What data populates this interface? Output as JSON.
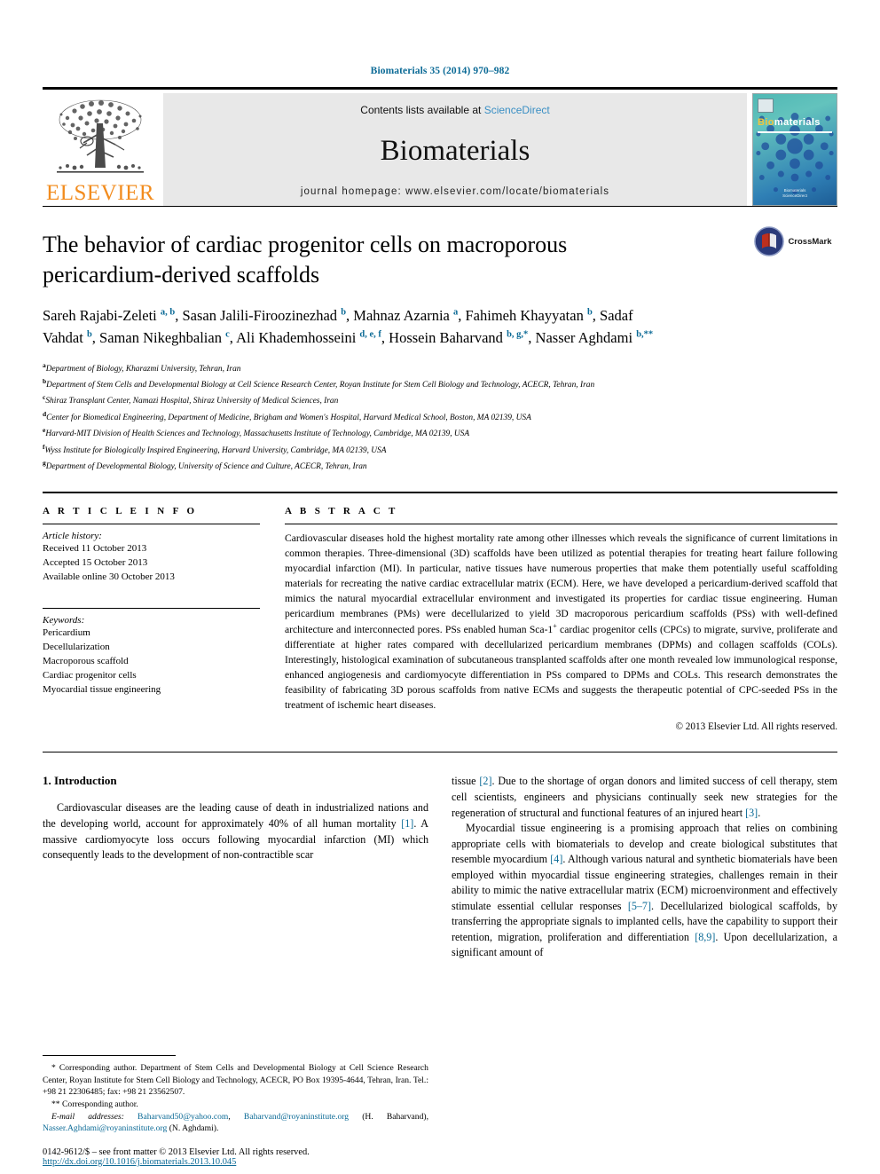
{
  "running_head": "Biomaterials 35 (2014) 970–982",
  "masthead": {
    "publisher_name": "ELSEVIER",
    "contents_prefix": "Contents lists available at ",
    "sciencedirect": "ScienceDirect",
    "journal_title": "Biomaterials",
    "homepage": "journal homepage: www.elsevier.com/locate/biomaterials",
    "cover": {
      "word_bio": "Bio",
      "word_rest": "materials",
      "footer_line1": "Biomaterials",
      "footer_line2": "ScienceDirect"
    }
  },
  "title": "The behavior of cardiac progenitor cells on macroporous pericardium-derived scaffolds",
  "crossmark_label": "CrossMark",
  "authors_html": "Sareh Rajabi-Zeleti <sup>a, b</sup>, Sasan Jalili-Firoozinezhad <sup>b</sup>, Mahnaz Azarnia <sup>a</sup>, Fahimeh Khayyatan <sup>b</sup>, Sadaf Vahdat <sup>b</sup>, Saman Nikeghbalian <sup>c</sup>, Ali Khademhosseini <sup>d, e, f</sup>, Hossein Baharvand <sup>b, g,</sup><sup>*</sup>, Nasser Aghdami <sup>b,</sup><sup>**</sup>",
  "affiliations": [
    {
      "marker": "a",
      "text": "Department of Biology, Kharazmi University, Tehran, Iran"
    },
    {
      "marker": "b",
      "text": "Department of Stem Cells and Developmental Biology at Cell Science Research Center, Royan Institute for Stem Cell Biology and Technology, ACECR, Tehran, Iran"
    },
    {
      "marker": "c",
      "text": "Shiraz Transplant Center, Namazi Hospital, Shiraz University of Medical Sciences, Iran"
    },
    {
      "marker": "d",
      "text": "Center for Biomedical Engineering, Department of Medicine, Brigham and Women's Hospital, Harvard Medical School, Boston, MA 02139, USA"
    },
    {
      "marker": "e",
      "text": "Harvard-MIT Division of Health Sciences and Technology, Massachusetts Institute of Technology, Cambridge, MA 02139, USA"
    },
    {
      "marker": "f",
      "text": "Wyss Institute for Biologically Inspired Engineering, Harvard University, Cambridge, MA 02139, USA"
    },
    {
      "marker": "g",
      "text": "Department of Developmental Biology, University of Science and Culture, ACECR, Tehran, Iran"
    }
  ],
  "article_info": {
    "heading": "A R T I C L E   I N F O",
    "history_label": "Article history:",
    "history": [
      "Received 11 October 2013",
      "Accepted 15 October 2013",
      "Available online 30 October 2013"
    ],
    "keywords_label": "Keywords:",
    "keywords": [
      "Pericardium",
      "Decellularization",
      "Macroporous scaffold",
      "Cardiac progenitor cells",
      "Myocardial tissue engineering"
    ]
  },
  "abstract": {
    "heading": "A B S T R A C T",
    "part1": "Cardiovascular diseases hold the highest mortality rate among other illnesses which reveals the significance of current limitations in common therapies. Three-dimensional (3D) scaffolds have been utilized as potential therapies for treating heart failure following myocardial infarction (MI). In particular, native tissues have numerous properties that make them potentially useful scaffolding materials for recreating the native cardiac extracellular matrix (ECM). Here, we have developed a pericardium-derived scaffold that mimics the natural myocardial extracellular environment and investigated its properties for cardiac tissue engineering. Human pericardium membranes (PMs) were decellularized to yield 3D macroporous pericardium scaffolds (PSs) with well-defined architecture and interconnected pores. PSs enabled human Sca-1",
    "sup": "+",
    "part2": " cardiac progenitor cells (CPCs) to migrate, survive, proliferate and differentiate at higher rates compared with decellularized pericardium membranes (DPMs) and collagen scaffolds (COLs). Interestingly, histological examination of subcutaneous transplanted scaffolds after one month revealed low immunological response, enhanced angiogenesis and cardiomyocyte differentiation in PSs compared to DPMs and COLs. This research demonstrates the feasibility of fabricating 3D porous scaffolds from native ECMs and suggests the therapeutic potential of CPC-seeded PSs in the treatment of ischemic heart diseases.",
    "copyright": "© 2013 Elsevier Ltd. All rights reserved."
  },
  "body": {
    "section_heading": "1. Introduction",
    "left_par1_a": "Cardiovascular diseases are the leading cause of death in industrialized nations and the developing world, account for approximately 40% of all human mortality ",
    "left_ref1": "[1]",
    "left_par1_b": ". A massive cardiomyocyte loss occurs following myocardial infarction (MI) which consequently leads to the development of non-contractible scar",
    "right_par1_a": "tissue ",
    "right_ref2": "[2]",
    "right_par1_b": ". Due to the shortage of organ donors and limited success of cell therapy, stem cell scientists, engineers and physicians continually seek new strategies for the regeneration of structural and functional features of an injured heart ",
    "right_ref3": "[3]",
    "right_par1_c": ".",
    "right_par2_a": "Myocardial tissue engineering is a promising approach that relies on combining appropriate cells with biomaterials to develop and create biological substitutes that resemble myocardium ",
    "right_ref4": "[4]",
    "right_par2_b": ". Although various natural and synthetic biomaterials have been employed within myocardial tissue engineering strategies, challenges remain in their ability to mimic the native extracellular matrix (ECM) microenvironment and effectively stimulate essential cellular responses ",
    "right_ref57": "[5–7]",
    "right_par2_c": ". Decellularized biological scaffolds, by transferring the appropriate signals to implanted cells, have the capability to support their retention, migration, proliferation and differentiation ",
    "right_ref89": "[8,9]",
    "right_par2_d": ". Upon decellularization, a significant amount of"
  },
  "footnotes": {
    "star_marker": "*",
    "star_text": "Corresponding author. Department of Stem Cells and Developmental Biology at Cell Science Research Center, Royan Institute for Stem Cell Biology and Technology, ACECR, PO Box 19395-4644, Tehran, Iran. Tel.: +98 21 22306485; fax: +98 21 23562507.",
    "dstar_marker": "**",
    "dstar_text": "Corresponding author.",
    "email_label": "E-mail addresses:",
    "email1": "Baharvand50@yahoo.com",
    "email_sep1": ", ",
    "email2": "Baharvand@royaninstitute.org",
    "email_attr1": " (H. Baharvand), ",
    "email3": "Nasser.Aghdami@royaninstitute.org",
    "email_attr2": " (N. Aghdami).",
    "issn_line": "0142-9612/$ – see front matter © 2013 Elsevier Ltd. All rights reserved.",
    "doi": "http://dx.doi.org/10.1016/j.biomaterials.2013.10.045"
  },
  "colors": {
    "link_blue": "#0b6a96",
    "sciencedirect_blue": "#3a8fc4",
    "elsevier_orange": "#F28C1E",
    "masthead_gray": "#e8e8e8"
  }
}
